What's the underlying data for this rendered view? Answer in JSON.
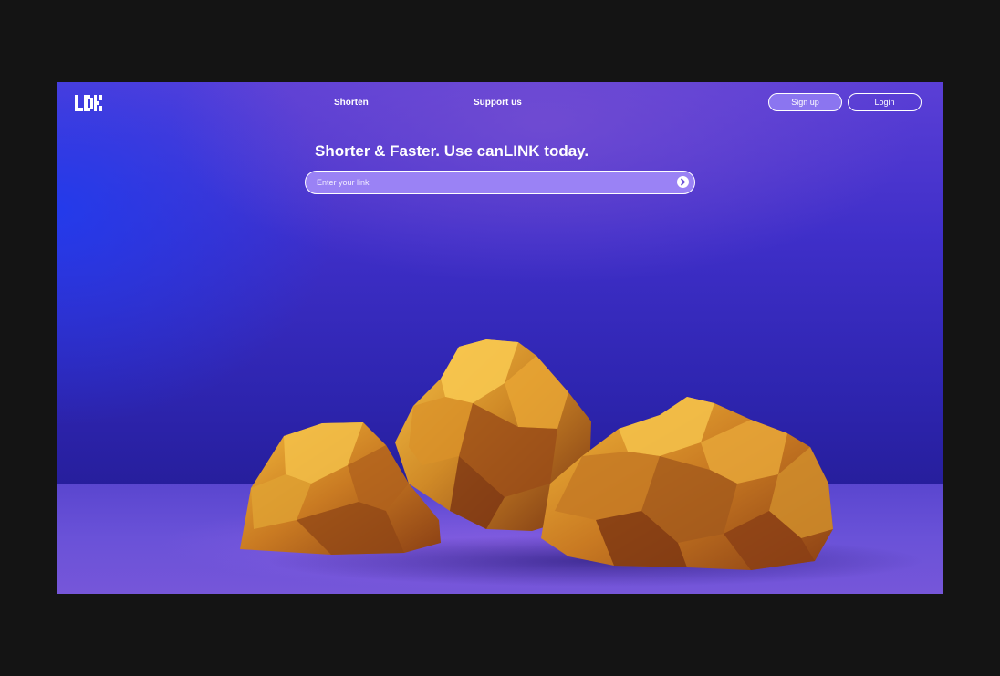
{
  "app": {
    "brand": "canLINK",
    "logo_icon": "ldk-pixel-logo"
  },
  "nav": {
    "shorten_label": "Shorten",
    "support_label": "Support us"
  },
  "auth": {
    "signup_label": "Sign up",
    "login_label": "Login"
  },
  "hero": {
    "headline": "Shorter & Faster. Use canLINK today.",
    "input_placeholder": "Enter your link",
    "input_value": "",
    "submit_icon": "chevron-right-circle-icon"
  },
  "colors": {
    "background_outer": "#141414",
    "hero_purple": "#3f2fc9",
    "signup_fill": "#8b75f0",
    "input_fill": "#9a82f5",
    "rock_gold": "#d99a2b"
  }
}
